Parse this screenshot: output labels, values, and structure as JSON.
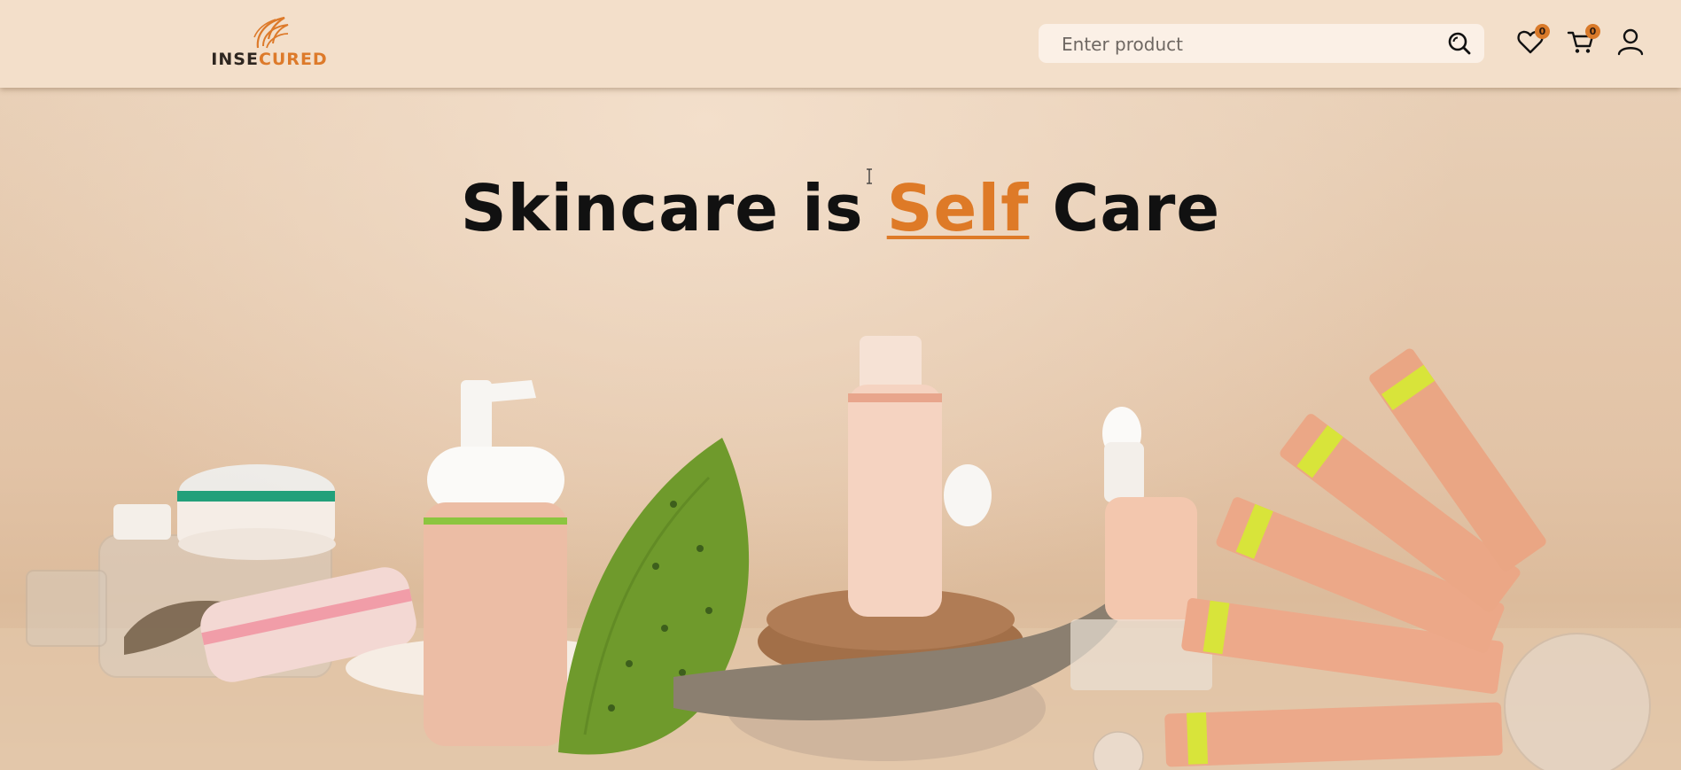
{
  "header": {
    "logo": {
      "text_dark": "INSE",
      "text_accent": "CURED"
    },
    "search": {
      "placeholder": "Enter product",
      "value": ""
    },
    "wishlist": {
      "count": "0"
    },
    "cart": {
      "count": "0"
    }
  },
  "hero": {
    "title_before": "Skincare is ",
    "title_accent": "Self",
    "title_after": " Care"
  },
  "colors": {
    "header_bg": "#f3dfca",
    "accent": "#de7a27",
    "badge": "#d97a2a",
    "title": "#111111"
  },
  "icons": [
    "logo-feather-icon",
    "search-icon",
    "heart-icon",
    "cart-icon",
    "user-icon",
    "text-cursor-icon"
  ]
}
